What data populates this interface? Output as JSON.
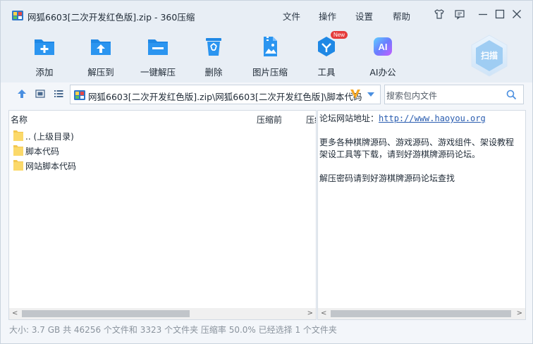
{
  "window": {
    "title": "网狐6603[二次开发红色版].zip - 360压缩"
  },
  "menu": {
    "file": "文件",
    "operate": "操作",
    "settings": "设置",
    "help": "帮助"
  },
  "toolbar": {
    "add": "添加",
    "extract_to": "解压到",
    "one_click_extract": "一键解压",
    "delete": "删除",
    "image_compress": "图片压缩",
    "tools": "工具",
    "tools_badge": "New",
    "ai_office": "AI办公",
    "ai_icon_text": "AI",
    "scan": "扫描"
  },
  "address": {
    "path": "网狐6603[二次开发红色版].zip\\网狐6603[二次开发红色版]\\脚本代码",
    "search_placeholder": "搜索包内文件"
  },
  "file_list": {
    "columns": [
      "名称",
      "压缩前",
      "压缩后"
    ],
    "rows": [
      {
        "name": ".. (上级目录)"
      },
      {
        "name": "脚本代码"
      },
      {
        "name": "网站脚本代码"
      }
    ]
  },
  "info_panel": {
    "line1_label": "论坛网站地址：",
    "line1_link": "http://www.haoyou.org",
    "line2": "更多各种棋牌源码、游戏源码、游戏组件、架设教程",
    "line3": "架设工具等下载，请到好游棋牌源码论坛。",
    "line4": "解压密码请到好游棋牌源码论坛查找"
  },
  "status": {
    "text": "大小: 3.7 GB 共 46256 个文件和 3323 个文件夹 压缩率 50.0% 已经选择 1 个文件夹"
  },
  "colors": {
    "accent_blue": "#1f88e5",
    "chrome": "#e8eef5"
  }
}
